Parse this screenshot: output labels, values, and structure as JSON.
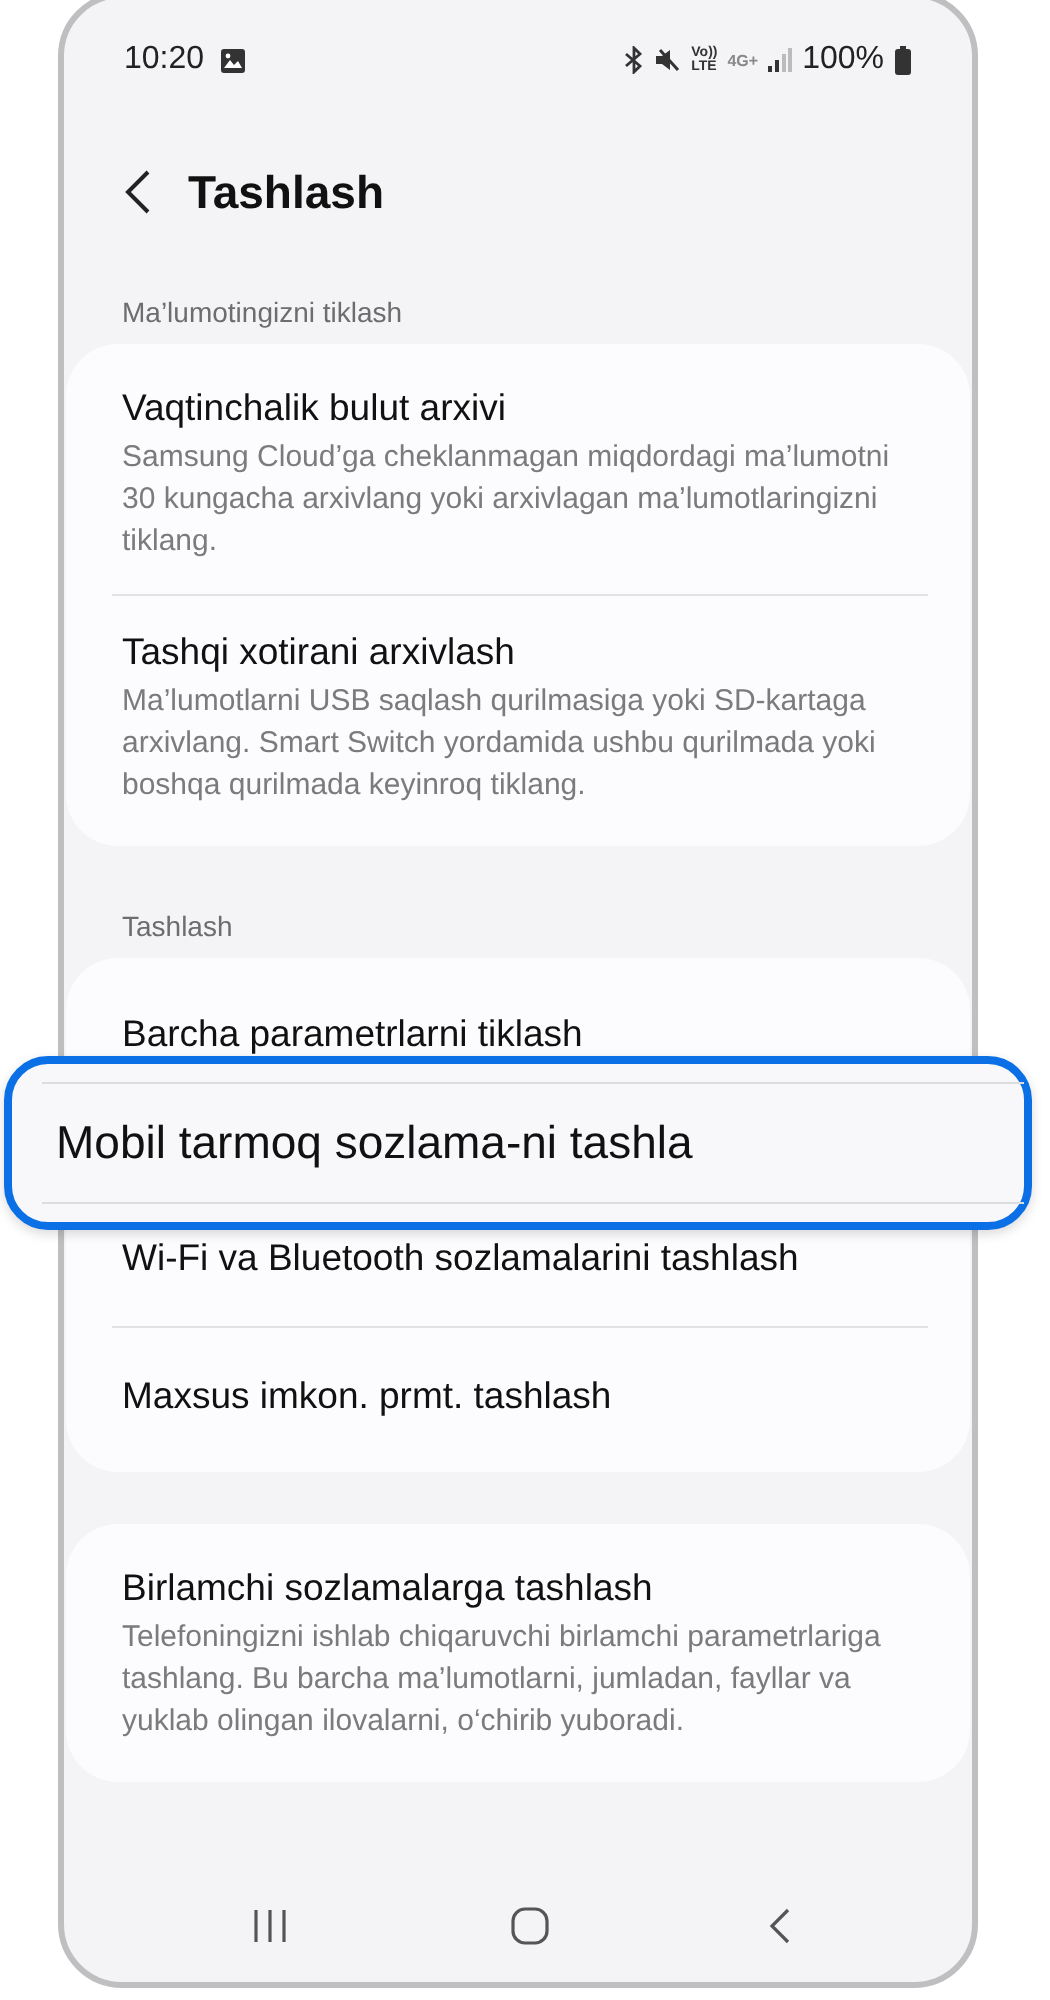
{
  "status_bar": {
    "time": "10:20",
    "volte_top": "Vo))",
    "volte_bottom": "LTE",
    "network": "4G+",
    "battery": "100%"
  },
  "header": {
    "title": "Tashlash"
  },
  "sections": [
    {
      "label": "Ma’lumotingizni tiklash",
      "items": [
        {
          "title": "Vaqtinchalik bulut arxivi",
          "description": "Samsung Cloud’ga cheklanmagan miqdordagi ma’lumotni 30 kungacha arxivlang yoki arxivlagan ma’lumotlaringizni tiklang.",
          "highlighted": false
        },
        {
          "title": "Tashqi xotirani arxivlash",
          "description": "Ma’lumotlarni USB saqlash qurilmasiga yoki SD-kartaga arxivlang. Smart Switch yordamida ushbu qurilmada yoki boshqa qurilmada keyinroq tiklang.",
          "highlighted": false
        }
      ]
    },
    {
      "label": "Tashlash",
      "items": [
        {
          "title": "Barcha parametrlarni tiklash",
          "highlighted": false
        },
        {
          "title": "Mobil tarmoq sozlama-ni tashla",
          "highlighted": true
        },
        {
          "title": "Wi-Fi va Bluetooth sozlamalarini tashlash",
          "highlighted": false
        },
        {
          "title": "Maxsus imkon. prmt. tashlash",
          "highlighted": false
        }
      ]
    },
    {
      "items": [
        {
          "title": "Birlamchi sozlamalarga tashlash",
          "description": "Telefoningizni ishlab chiqaruvchi birlamchi parametrlariga tashlang. Bu barcha ma’lumotlarni, jumladan, fayllar va yuklab olingan ilovalarni, o‘chirib yuboradi.",
          "highlighted": false
        }
      ]
    }
  ]
}
